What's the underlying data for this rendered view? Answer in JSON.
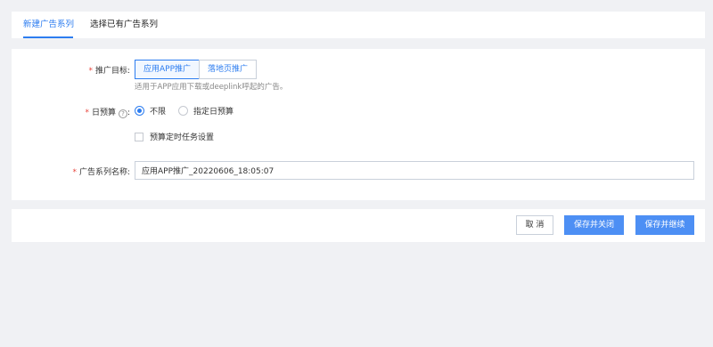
{
  "tabs": [
    {
      "label": "新建广告系列"
    },
    {
      "label": "选择已有广告系列"
    }
  ],
  "form": {
    "promo_target": {
      "label": "推广目标:",
      "options": [
        "应用APP推广",
        "落地页推广"
      ],
      "help": "适用于APP应用下载或deeplink呼起的广告。"
    },
    "daily_budget": {
      "label": "日预算",
      "help_icon": "?",
      "colon": ":",
      "options": [
        "不限",
        "指定日预算"
      ]
    },
    "schedule": {
      "label": "预算定时任务设置"
    },
    "series_name": {
      "label": "广告系列名称:",
      "value": "应用APP推广_20220606_18:05:07"
    },
    "required_mark": "*"
  },
  "footer": {
    "cancel": "取 消",
    "save_close": "保存并关闭",
    "save_continue": "保存并继续"
  },
  "colors": {
    "accent": "#2d7df0",
    "required": "#e8433a",
    "primary_button": "#4d8ff4"
  }
}
